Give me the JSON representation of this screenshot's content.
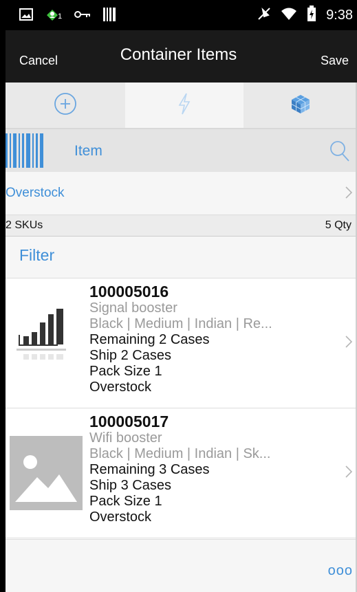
{
  "status_bar": {
    "time": "9:38",
    "left_icons": [
      "image-icon",
      "account-badge-icon",
      "key-icon",
      "barcode-icon"
    ],
    "right_icons": [
      "mute-icon",
      "wifi-icon",
      "battery-icon"
    ],
    "badge": "1"
  },
  "title_bar": {
    "cancel_label": "Cancel",
    "title": "Container Items",
    "save_label": "Save"
  },
  "tabs": [
    {
      "icon": "add-circle-icon"
    },
    {
      "icon": "lightning-icon"
    },
    {
      "icon": "cube-icon"
    }
  ],
  "scan": {
    "label": "Item"
  },
  "location": {
    "label": "Overstock"
  },
  "summary": {
    "skus": "2 SKUs",
    "qty": "5 Qty"
  },
  "filter": {
    "label": "Filter"
  },
  "items": [
    {
      "sku": "100005016",
      "description": "Signal booster",
      "attributes": "Black | Medium | Indian | Re...",
      "remaining": "Remaining  2 Cases",
      "ship": "Ship  2 Cases",
      "pack_size": "Pack Size 1",
      "location": "Overstock",
      "thumbnail": "signal-bars-icon"
    },
    {
      "sku": "100005017",
      "description": "Wifi booster",
      "attributes": "Black | Medium | Indian | Sk...",
      "remaining": "Remaining  3 Cases",
      "ship": "Ship  3 Cases",
      "pack_size": "Pack Size 1",
      "location": "Overstock",
      "thumbnail": "image-placeholder-icon"
    }
  ],
  "more_label": "ooo",
  "colors": {
    "accent": "#3f8fd8",
    "title_bar": "#1a1a1a",
    "status_bar": "#000000"
  }
}
